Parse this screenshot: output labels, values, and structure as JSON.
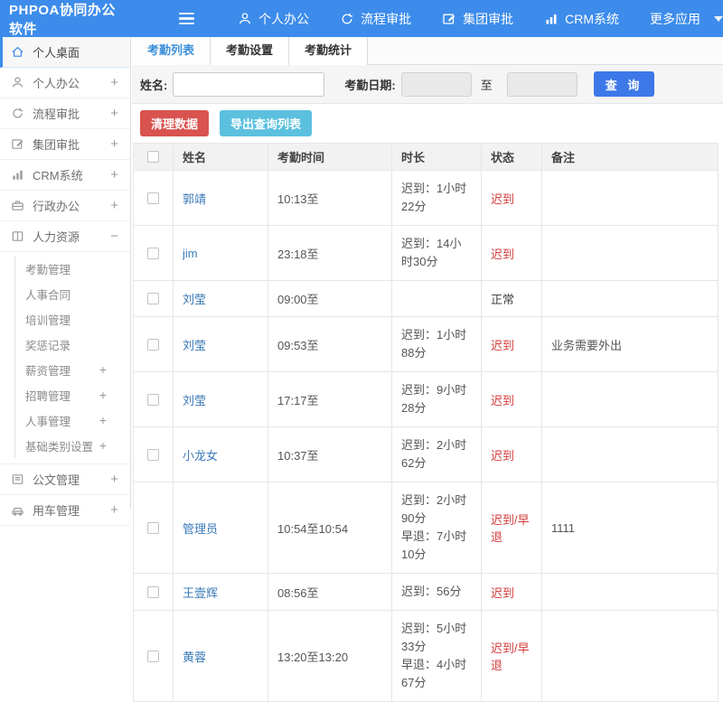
{
  "header": {
    "title": "PHPOA协同办公软件",
    "nav": [
      {
        "label": "个人办公",
        "icon": "person-icon"
      },
      {
        "label": "流程审批",
        "icon": "cycle-icon"
      },
      {
        "label": "集团审批",
        "icon": "edit-icon"
      },
      {
        "label": "CRM系统",
        "icon": "chart-icon"
      },
      {
        "label": "更多应用",
        "icon": "caret-down-icon"
      }
    ]
  },
  "sidebar": {
    "items": [
      {
        "label": "个人桌面",
        "icon": "home-icon",
        "active": true,
        "expand": ""
      },
      {
        "label": "个人办公",
        "icon": "person-icon",
        "expand": "+"
      },
      {
        "label": "流程审批",
        "icon": "cycle-icon",
        "expand": "+"
      },
      {
        "label": "集团审批",
        "icon": "edit-icon",
        "expand": "+"
      },
      {
        "label": "CRM系统",
        "icon": "chart-icon",
        "expand": "+"
      },
      {
        "label": "行政办公",
        "icon": "briefcase-icon",
        "expand": "+"
      },
      {
        "label": "人力资源",
        "icon": "book-icon",
        "expand": "−",
        "children": [
          {
            "label": "考勤管理",
            "expand": ""
          },
          {
            "label": "人事合同",
            "expand": ""
          },
          {
            "label": "培训管理",
            "expand": ""
          },
          {
            "label": "奖惩记录",
            "expand": ""
          },
          {
            "label": "薪资管理",
            "expand": "+"
          },
          {
            "label": "招聘管理",
            "expand": "+"
          },
          {
            "label": "人事管理",
            "expand": "+"
          },
          {
            "label": "基础类别设置",
            "expand": "+"
          }
        ]
      },
      {
        "label": "公文管理",
        "icon": "doc-icon",
        "expand": "+"
      },
      {
        "label": "用车管理",
        "icon": "car-icon",
        "expand": "+"
      }
    ]
  },
  "tabs": [
    {
      "label": "考勤列表",
      "active": true
    },
    {
      "label": "考勤设置",
      "active": false
    },
    {
      "label": "考勤统计",
      "active": false
    }
  ],
  "filter": {
    "name_label": "姓名:",
    "name_value": "",
    "date_label": "考勤日期:",
    "date_from_value": "",
    "to_label": "至",
    "date_to_value": "",
    "search_button": "查 询"
  },
  "actions": {
    "clean_button": "清理数据",
    "export_button": "导出查询列表"
  },
  "table": {
    "columns": {
      "name": "姓名",
      "time": "考勤时间",
      "duration": "时长",
      "status": "状态",
      "remark": "备注"
    },
    "rows": [
      {
        "name": "郭靖",
        "time": "10:13至",
        "dur1": "迟到：1小时22分",
        "dur2": "",
        "status": "迟到",
        "status_class": "st-red",
        "remark": ""
      },
      {
        "name": "jim",
        "time": "23:18至",
        "dur1": "迟到：14小时30分",
        "dur2": "",
        "status": "迟到",
        "status_class": "st-red",
        "remark": ""
      },
      {
        "name": "刘莹",
        "time": "09:00至",
        "dur1": "",
        "dur2": "",
        "status": "正常",
        "status_class": "st-plain",
        "remark": ""
      },
      {
        "name": "刘莹",
        "time": "09:53至",
        "dur1": "迟到：1小时88分",
        "dur2": "",
        "status": "迟到",
        "status_class": "st-red",
        "remark": "业务需要外出"
      },
      {
        "name": "刘莹",
        "time": "17:17至",
        "dur1": "迟到：9小时28分",
        "dur2": "",
        "status": "迟到",
        "status_class": "st-red",
        "remark": ""
      },
      {
        "name": "小龙女",
        "time": "10:37至",
        "dur1": "迟到：2小时62分",
        "dur2": "",
        "status": "迟到",
        "status_class": "st-red",
        "remark": ""
      },
      {
        "name": "管理员",
        "time": "10:54至10:54",
        "dur1": "迟到：2小时90分",
        "dur2": "早退：7小时10分",
        "status": "迟到/早退",
        "status_class": "st-red",
        "remark": "1111"
      },
      {
        "name": "王壹辉",
        "time": "08:56至",
        "dur1": "迟到：56分",
        "dur2": "",
        "status": "迟到",
        "status_class": "st-red",
        "remark": ""
      },
      {
        "name": "黄蓉",
        "time": "13:20至13:20",
        "dur1": "迟到：5小时33分",
        "dur2": "早退：4小时67分",
        "status": "迟到/早退",
        "status_class": "st-red",
        "remark": ""
      }
    ]
  },
  "colors": {
    "header_bg": "#3d8ceb",
    "active_tab_blue": "#3a8fd8",
    "link_blue": "#3a7ab8",
    "danger_red": "#d9534f",
    "status_red": "#d43c3c",
    "export_teal": "#5bc0de",
    "query_blue": "#3d78e8"
  }
}
